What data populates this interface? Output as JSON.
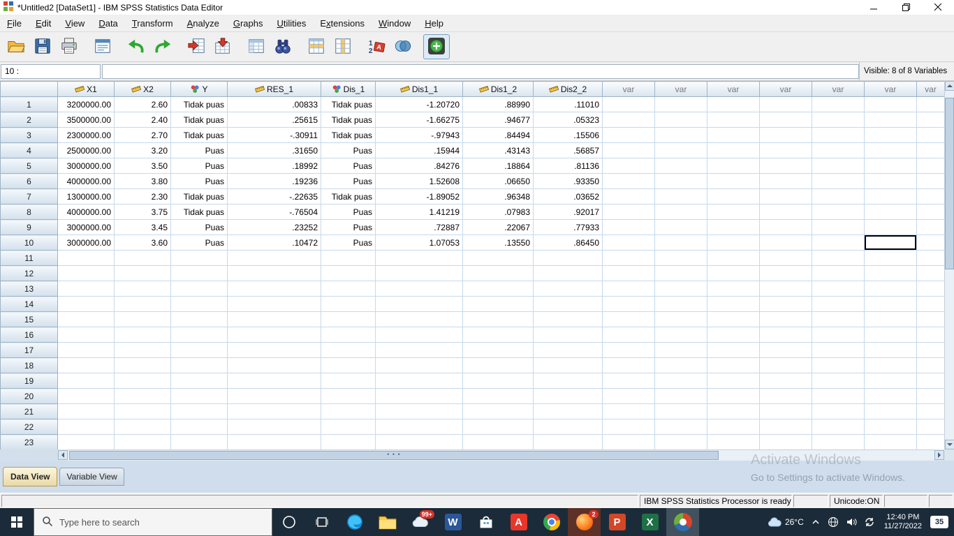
{
  "window": {
    "title": "*Untitled2 [DataSet1] - IBM SPSS Statistics Data Editor"
  },
  "menu": {
    "items": [
      {
        "label": "File",
        "u": 0
      },
      {
        "label": "Edit",
        "u": 0
      },
      {
        "label": "View",
        "u": 0
      },
      {
        "label": "Data",
        "u": 0
      },
      {
        "label": "Transform",
        "u": 0
      },
      {
        "label": "Analyze",
        "u": 0
      },
      {
        "label": "Graphs",
        "u": 0
      },
      {
        "label": "Utilities",
        "u": 0
      },
      {
        "label": "Extensions",
        "u": 1
      },
      {
        "label": "Window",
        "u": 0
      },
      {
        "label": "Help",
        "u": 0
      }
    ]
  },
  "toolbar": {
    "buttons": [
      "open-data",
      "save",
      "print",
      "recall-dialogs",
      "undo",
      "redo",
      "goto-case",
      "goto-variable",
      "variables",
      "find",
      "insert-cases",
      "insert-variable",
      "value-labels",
      "split-file",
      "use-variable-sets"
    ]
  },
  "cellref": {
    "row_label": "10 :",
    "value": "",
    "visible_info": "Visible: 8 of 8 Variables"
  },
  "grid": {
    "columns": [
      {
        "name": "X1",
        "type": "scale"
      },
      {
        "name": "X2",
        "type": "scale"
      },
      {
        "name": "Y",
        "type": "nominal"
      },
      {
        "name": "RES_1",
        "type": "scale"
      },
      {
        "name": "Dis_1",
        "type": "nominal"
      },
      {
        "name": "Dis1_1",
        "type": "scale"
      },
      {
        "name": "Dis1_2",
        "type": "scale"
      },
      {
        "name": "Dis2_2",
        "type": "scale"
      },
      {
        "name": "var",
        "type": "empty"
      },
      {
        "name": "var",
        "type": "empty"
      },
      {
        "name": "var",
        "type": "empty"
      },
      {
        "name": "var",
        "type": "empty"
      },
      {
        "name": "var",
        "type": "empty"
      },
      {
        "name": "var",
        "type": "empty"
      },
      {
        "name": "var",
        "type": "empty"
      }
    ],
    "rows": [
      [
        "3200000.00",
        "2.60",
        "Tidak puas",
        ".00833",
        "Tidak puas",
        "-1.20720",
        ".88990",
        ".11010"
      ],
      [
        "3500000.00",
        "2.40",
        "Tidak puas",
        ".25615",
        "Tidak puas",
        "-1.66275",
        ".94677",
        ".05323"
      ],
      [
        "2300000.00",
        "2.70",
        "Tidak puas",
        "-.30911",
        "Tidak puas",
        "-.97943",
        ".84494",
        ".15506"
      ],
      [
        "2500000.00",
        "3.20",
        "Puas",
        ".31650",
        "Puas",
        ".15944",
        ".43143",
        ".56857"
      ],
      [
        "3000000.00",
        "3.50",
        "Puas",
        ".18992",
        "Puas",
        ".84276",
        ".18864",
        ".81136"
      ],
      [
        "4000000.00",
        "3.80",
        "Puas",
        ".19236",
        "Puas",
        "1.52608",
        ".06650",
        ".93350"
      ],
      [
        "1300000.00",
        "2.30",
        "Tidak puas",
        "-.22635",
        "Tidak puas",
        "-1.89052",
        ".96348",
        ".03652"
      ],
      [
        "4000000.00",
        "3.75",
        "Tidak puas",
        "-.76504",
        "Puas",
        "1.41219",
        ".07983",
        ".92017"
      ],
      [
        "3000000.00",
        "3.45",
        "Puas",
        ".23252",
        "Puas",
        ".72887",
        ".22067",
        ".77933"
      ],
      [
        "3000000.00",
        "3.60",
        "Puas",
        ".10472",
        "Puas",
        "1.07053",
        ".13550",
        ".86450"
      ]
    ],
    "total_rows": 23,
    "selected_cell": {
      "row": 10,
      "col": 13
    }
  },
  "tabs": {
    "data_view": "Data View",
    "variable_view": "Variable View"
  },
  "statusbar": {
    "message": "IBM SPSS Statistics Processor is ready",
    "unicode": "Unicode:ON"
  },
  "watermark": {
    "line1": "Activate Windows",
    "line2": "Go to Settings to activate Windows."
  },
  "taskbar": {
    "search_placeholder": "Type here to search",
    "apps": [
      {
        "name": "edge"
      },
      {
        "name": "file-explorer"
      },
      {
        "name": "news",
        "badge": "99+"
      },
      {
        "name": "word",
        "letter": "W",
        "color": "#2b579a"
      },
      {
        "name": "store"
      },
      {
        "name": "adobe",
        "letter": "A",
        "color": "#e8362a"
      },
      {
        "name": "chrome"
      },
      {
        "name": "orange-app",
        "badge": "2",
        "highlight": true
      },
      {
        "name": "powerpoint",
        "letter": "P",
        "color": "#d24726"
      },
      {
        "name": "excel",
        "letter": "X",
        "color": "#1e7145"
      },
      {
        "name": "spss",
        "active": true
      }
    ],
    "temperature": "26°C",
    "time": "12:40 PM",
    "date": "11/27/2022",
    "notification_count": "35"
  }
}
